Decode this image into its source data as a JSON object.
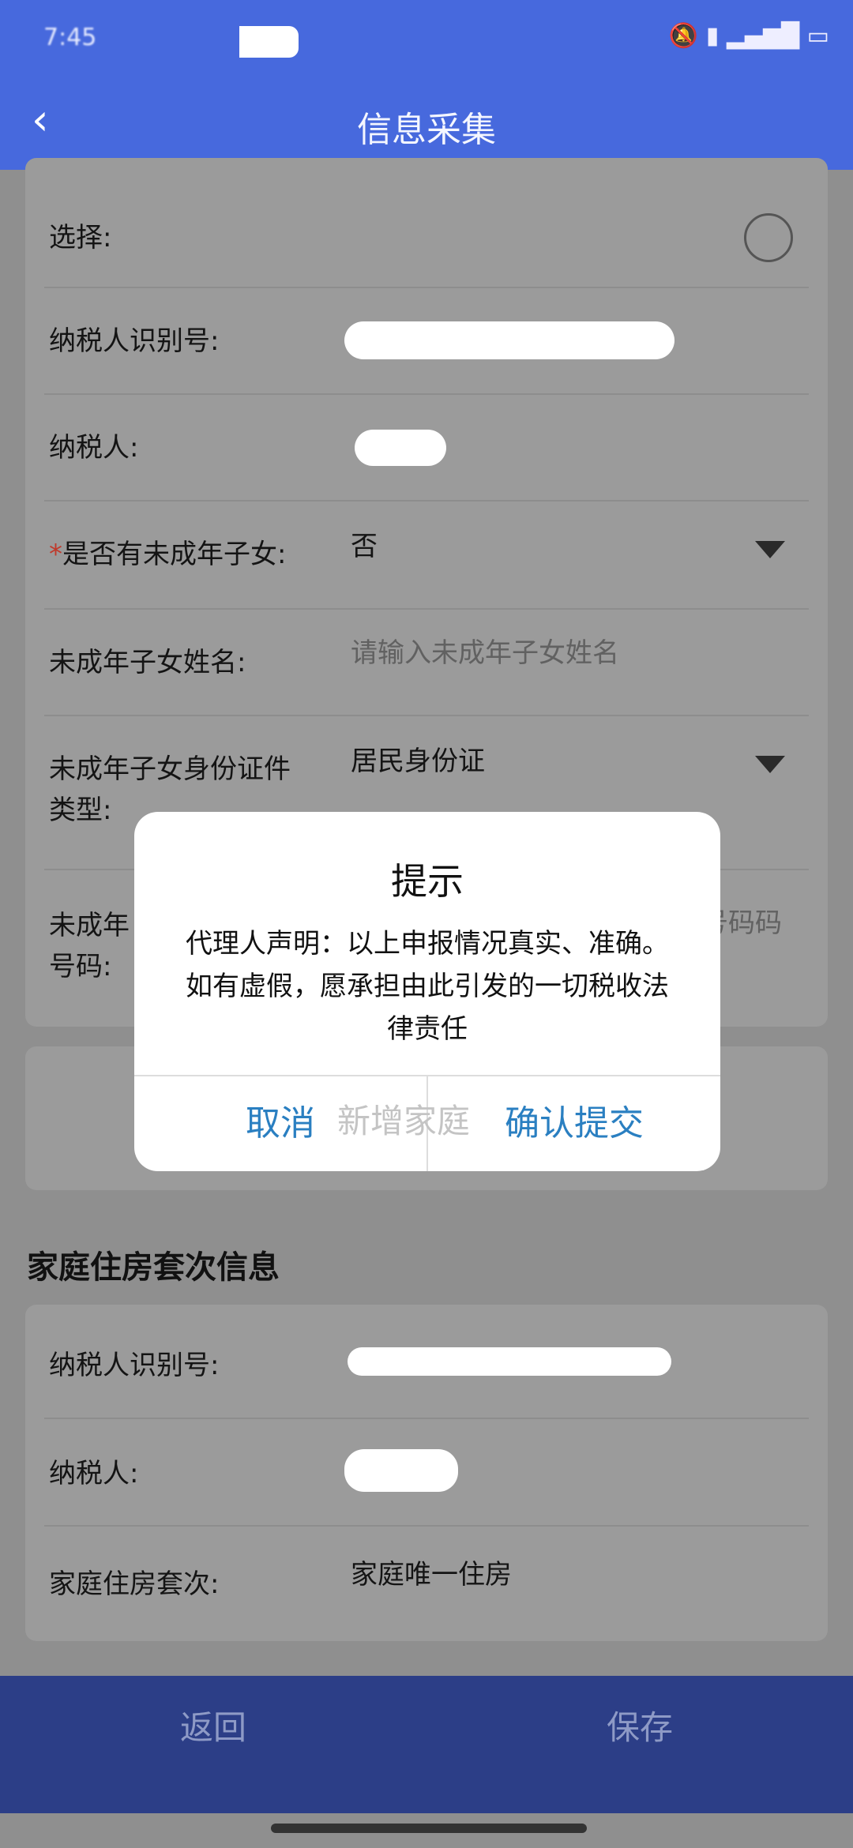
{
  "header": {
    "title": "信息采集",
    "back_icon": "chevron-left-icon"
  },
  "form": {
    "rows": [
      {
        "label": "选择:"
      },
      {
        "label": "纳税人识别号:"
      },
      {
        "label": "纳税人:"
      },
      {
        "required": "*",
        "label": "是否有未成年子女:",
        "value": "否"
      },
      {
        "label": "未成年子女姓名:",
        "placeholder": "请输入未成年子女姓名"
      },
      {
        "label": "未成年子女身份证件类型:",
        "label_line1": "未成年子女身份证件",
        "label_line2": "类型:",
        "value": "居民身份证"
      },
      {
        "label_line1": "未成年",
        "label_line2": "号码:",
        "placeholder_visible": "号码码"
      }
    ],
    "add_button": "新增家庭"
  },
  "housing": {
    "title": "家庭住房套次信息",
    "rows": [
      {
        "label": "纳税人识别号:"
      },
      {
        "label": "纳税人:"
      },
      {
        "label": "家庭住房套次:",
        "value": "家庭唯一住房"
      }
    ]
  },
  "nav": {
    "back": "返回",
    "save": "保存"
  },
  "dialog": {
    "title": "提示",
    "body": "代理人声明：以上申报情况真实、准确。如有虚假，愿承担由此引发的一切税收法律责任",
    "cancel": "取消",
    "confirm": "确认提交"
  },
  "colors": {
    "header": "#4769dd",
    "nav": "#2c3e87",
    "dialog_button": "#2a7fc1",
    "required": "#c0392b"
  }
}
